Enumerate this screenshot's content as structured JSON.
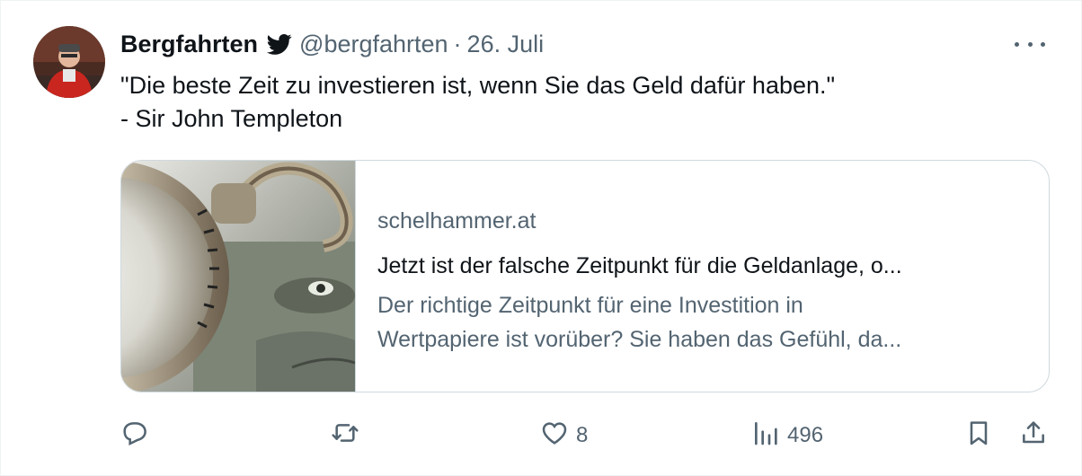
{
  "tweet": {
    "author_name": "Bergfahrten",
    "handle": "@bergfahrten",
    "separator": "·",
    "date": "26. Juli",
    "text_line1": "\"Die beste Zeit zu investieren ist, wenn Sie das Geld dafür haben.\"",
    "text_line2": "- Sir John Templeton"
  },
  "card": {
    "domain": "schelhammer.at",
    "title": "Jetzt ist der falsche Zeitpunkt für die Geldanlage, o...",
    "desc_line1": "Der richtige Zeitpunkt für eine Investition in",
    "desc_line2": "Wertpapiere ist vorüber? Sie haben das Gefühl, da..."
  },
  "actions": {
    "reply_count": "",
    "retweet_count": "",
    "like_count": "8",
    "views_count": "496"
  },
  "icons": [
    "twitter-bird-icon",
    "more-icon",
    "reply-icon",
    "retweet-icon",
    "like-icon",
    "views-icon",
    "bookmark-icon",
    "share-icon"
  ],
  "colors": {
    "text_primary": "#0f1419",
    "text_secondary": "#536471",
    "border": "#cfd9de",
    "brand": "#000000"
  }
}
